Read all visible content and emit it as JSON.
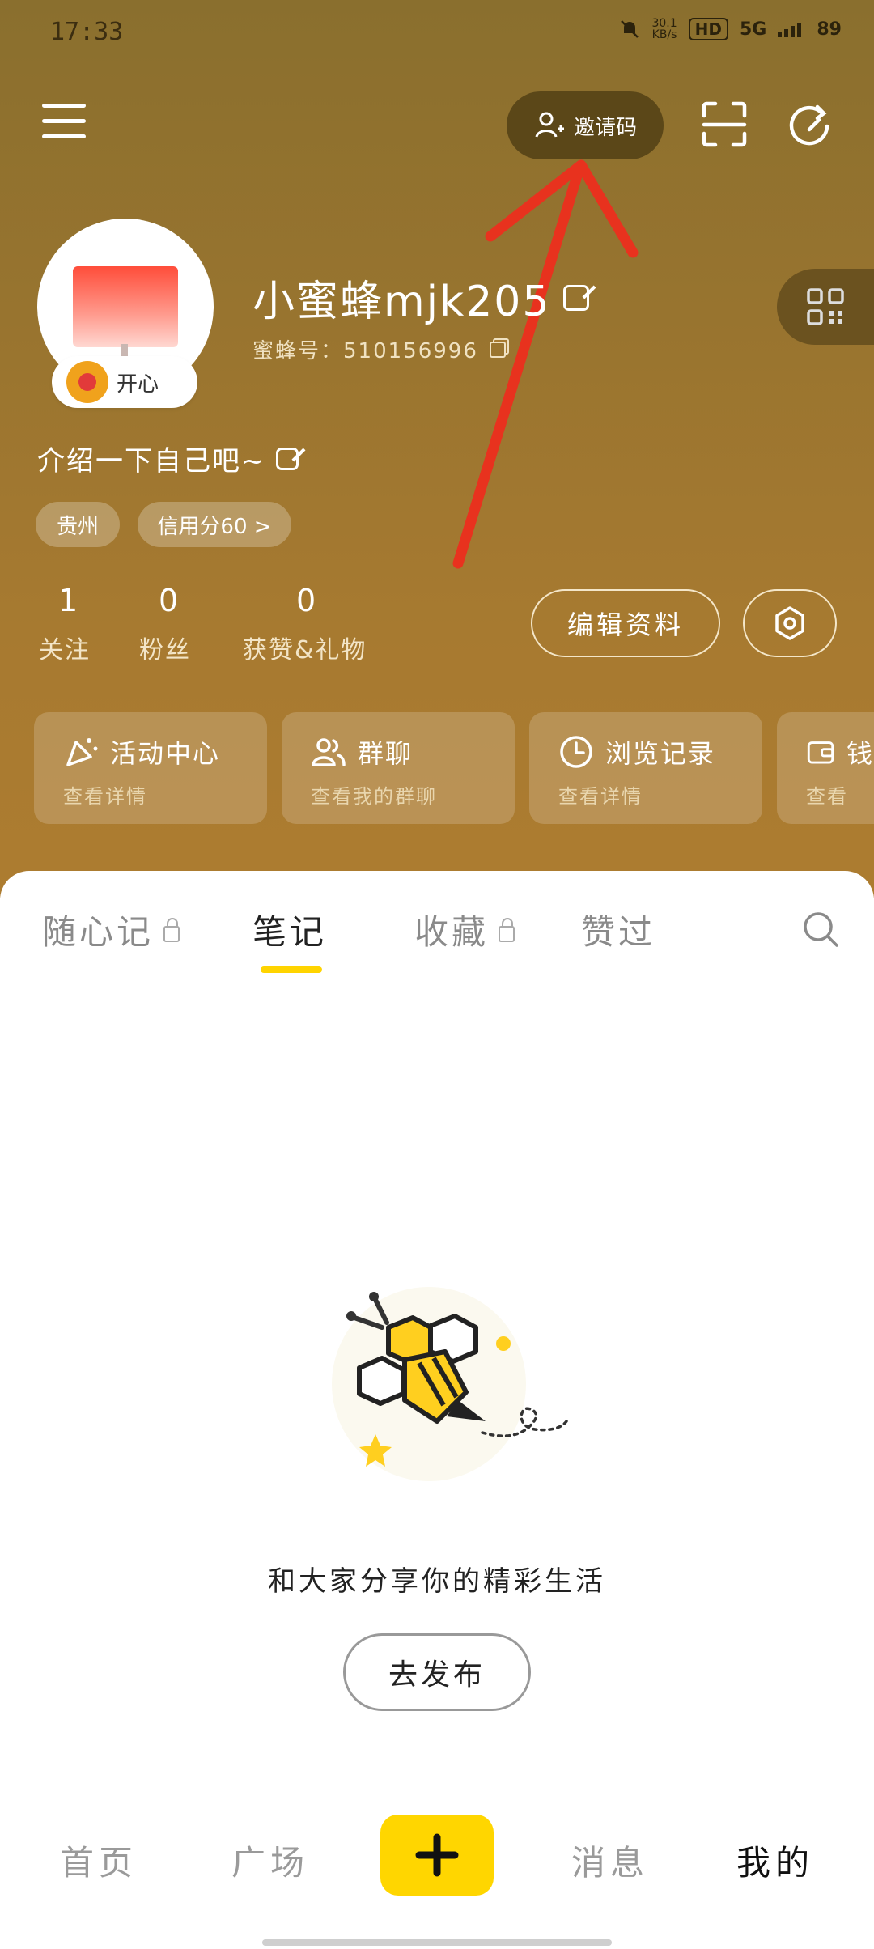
{
  "status_bar": {
    "time": "17:33",
    "speed": "30.1",
    "speed_unit": "KB/s",
    "hd": "HD",
    "network": "5G",
    "battery": "89"
  },
  "top_bar": {
    "invite_label": "邀请码"
  },
  "profile": {
    "username": "小蜜蜂mjk205",
    "user_id": "蜜蜂号：510156996",
    "mood": "开心",
    "bio": "介绍一下自己吧~",
    "tags": [
      "贵州",
      "信用分60 >"
    ]
  },
  "stats": [
    {
      "value": "1",
      "label": "关注"
    },
    {
      "value": "0",
      "label": "粉丝"
    },
    {
      "value": "0",
      "label": "获赞&礼物"
    }
  ],
  "actions": {
    "edit_profile": "编辑资料"
  },
  "quick_cards": [
    {
      "title": "活动中心",
      "subtitle": "查看详情"
    },
    {
      "title": "群聊",
      "subtitle": "查看我的群聊"
    },
    {
      "title": "浏览记录",
      "subtitle": "查看详情"
    },
    {
      "title": "钱",
      "subtitle": "查看"
    }
  ],
  "tabs": [
    {
      "label": "随心记",
      "locked": true
    },
    {
      "label": "笔记",
      "locked": false,
      "active": true
    },
    {
      "label": "收藏",
      "locked": true
    },
    {
      "label": "赞过",
      "locked": false
    }
  ],
  "empty_state": {
    "text": "和大家分享你的精彩生活",
    "button": "去发布"
  },
  "bottom_nav": [
    {
      "label": "首页"
    },
    {
      "label": "广场"
    },
    {
      "label": "消息"
    },
    {
      "label": "我的",
      "active": true
    }
  ],
  "colors": {
    "accent_yellow": "#FFD600",
    "header_brown": "#A77A30",
    "annotation_red": "#E8321E"
  }
}
